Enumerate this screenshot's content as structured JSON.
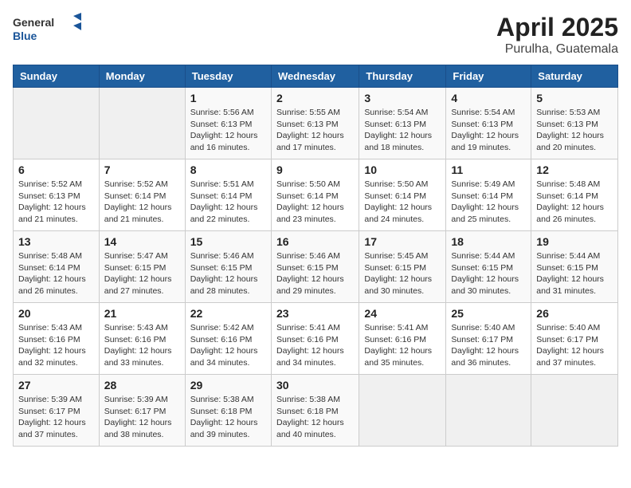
{
  "header": {
    "logo_general": "General",
    "logo_blue": "Blue",
    "month_year": "April 2025",
    "location": "Purulha, Guatemala"
  },
  "days_of_week": [
    "Sunday",
    "Monday",
    "Tuesday",
    "Wednesday",
    "Thursday",
    "Friday",
    "Saturday"
  ],
  "weeks": [
    [
      {
        "day": "",
        "detail": ""
      },
      {
        "day": "",
        "detail": ""
      },
      {
        "day": "1",
        "detail": "Sunrise: 5:56 AM\nSunset: 6:13 PM\nDaylight: 12 hours and 16 minutes."
      },
      {
        "day": "2",
        "detail": "Sunrise: 5:55 AM\nSunset: 6:13 PM\nDaylight: 12 hours and 17 minutes."
      },
      {
        "day": "3",
        "detail": "Sunrise: 5:54 AM\nSunset: 6:13 PM\nDaylight: 12 hours and 18 minutes."
      },
      {
        "day": "4",
        "detail": "Sunrise: 5:54 AM\nSunset: 6:13 PM\nDaylight: 12 hours and 19 minutes."
      },
      {
        "day": "5",
        "detail": "Sunrise: 5:53 AM\nSunset: 6:13 PM\nDaylight: 12 hours and 20 minutes."
      }
    ],
    [
      {
        "day": "6",
        "detail": "Sunrise: 5:52 AM\nSunset: 6:13 PM\nDaylight: 12 hours and 21 minutes."
      },
      {
        "day": "7",
        "detail": "Sunrise: 5:52 AM\nSunset: 6:14 PM\nDaylight: 12 hours and 21 minutes."
      },
      {
        "day": "8",
        "detail": "Sunrise: 5:51 AM\nSunset: 6:14 PM\nDaylight: 12 hours and 22 minutes."
      },
      {
        "day": "9",
        "detail": "Sunrise: 5:50 AM\nSunset: 6:14 PM\nDaylight: 12 hours and 23 minutes."
      },
      {
        "day": "10",
        "detail": "Sunrise: 5:50 AM\nSunset: 6:14 PM\nDaylight: 12 hours and 24 minutes."
      },
      {
        "day": "11",
        "detail": "Sunrise: 5:49 AM\nSunset: 6:14 PM\nDaylight: 12 hours and 25 minutes."
      },
      {
        "day": "12",
        "detail": "Sunrise: 5:48 AM\nSunset: 6:14 PM\nDaylight: 12 hours and 26 minutes."
      }
    ],
    [
      {
        "day": "13",
        "detail": "Sunrise: 5:48 AM\nSunset: 6:14 PM\nDaylight: 12 hours and 26 minutes."
      },
      {
        "day": "14",
        "detail": "Sunrise: 5:47 AM\nSunset: 6:15 PM\nDaylight: 12 hours and 27 minutes."
      },
      {
        "day": "15",
        "detail": "Sunrise: 5:46 AM\nSunset: 6:15 PM\nDaylight: 12 hours and 28 minutes."
      },
      {
        "day": "16",
        "detail": "Sunrise: 5:46 AM\nSunset: 6:15 PM\nDaylight: 12 hours and 29 minutes."
      },
      {
        "day": "17",
        "detail": "Sunrise: 5:45 AM\nSunset: 6:15 PM\nDaylight: 12 hours and 30 minutes."
      },
      {
        "day": "18",
        "detail": "Sunrise: 5:44 AM\nSunset: 6:15 PM\nDaylight: 12 hours and 30 minutes."
      },
      {
        "day": "19",
        "detail": "Sunrise: 5:44 AM\nSunset: 6:15 PM\nDaylight: 12 hours and 31 minutes."
      }
    ],
    [
      {
        "day": "20",
        "detail": "Sunrise: 5:43 AM\nSunset: 6:16 PM\nDaylight: 12 hours and 32 minutes."
      },
      {
        "day": "21",
        "detail": "Sunrise: 5:43 AM\nSunset: 6:16 PM\nDaylight: 12 hours and 33 minutes."
      },
      {
        "day": "22",
        "detail": "Sunrise: 5:42 AM\nSunset: 6:16 PM\nDaylight: 12 hours and 34 minutes."
      },
      {
        "day": "23",
        "detail": "Sunrise: 5:41 AM\nSunset: 6:16 PM\nDaylight: 12 hours and 34 minutes."
      },
      {
        "day": "24",
        "detail": "Sunrise: 5:41 AM\nSunset: 6:16 PM\nDaylight: 12 hours and 35 minutes."
      },
      {
        "day": "25",
        "detail": "Sunrise: 5:40 AM\nSunset: 6:17 PM\nDaylight: 12 hours and 36 minutes."
      },
      {
        "day": "26",
        "detail": "Sunrise: 5:40 AM\nSunset: 6:17 PM\nDaylight: 12 hours and 37 minutes."
      }
    ],
    [
      {
        "day": "27",
        "detail": "Sunrise: 5:39 AM\nSunset: 6:17 PM\nDaylight: 12 hours and 37 minutes."
      },
      {
        "day": "28",
        "detail": "Sunrise: 5:39 AM\nSunset: 6:17 PM\nDaylight: 12 hours and 38 minutes."
      },
      {
        "day": "29",
        "detail": "Sunrise: 5:38 AM\nSunset: 6:18 PM\nDaylight: 12 hours and 39 minutes."
      },
      {
        "day": "30",
        "detail": "Sunrise: 5:38 AM\nSunset: 6:18 PM\nDaylight: 12 hours and 40 minutes."
      },
      {
        "day": "",
        "detail": ""
      },
      {
        "day": "",
        "detail": ""
      },
      {
        "day": "",
        "detail": ""
      }
    ]
  ]
}
